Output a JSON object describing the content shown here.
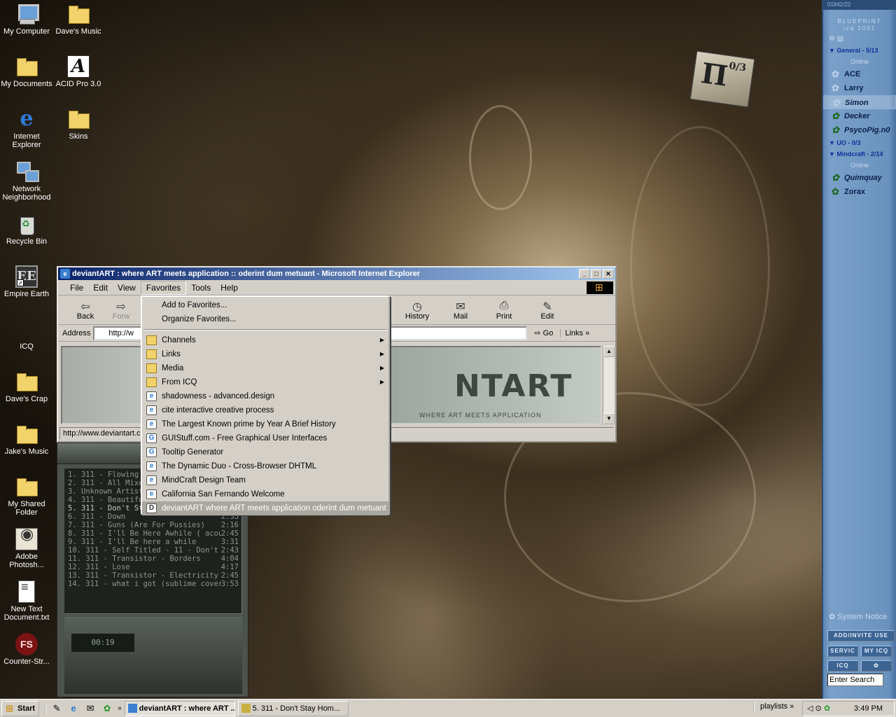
{
  "desktop": {
    "icons": [
      {
        "label": "My Computer",
        "icon": "computer-icon"
      },
      {
        "label": "Dave's Music",
        "icon": "folder-icon"
      },
      {
        "label": "My Documents",
        "icon": "folder-icon"
      },
      {
        "label": "ACID Pro 3.0",
        "icon": "acid-icon"
      },
      {
        "label": "Internet Explorer",
        "icon": "ie-icon"
      },
      {
        "label": "Skins",
        "icon": "folder-icon"
      },
      {
        "label": "Network Neighborhood",
        "icon": "network-icon"
      },
      {
        "label": "Recycle Bin",
        "icon": "recycle-bin-icon"
      },
      {
        "label": "Empire Earth",
        "icon": "empire-earth-icon"
      },
      {
        "label": "ICQ",
        "icon": "icq-icon"
      },
      {
        "label": "Dave's Crap",
        "icon": "folder-icon"
      },
      {
        "label": "Jake's Music",
        "icon": "folder-icon"
      },
      {
        "label": "My Shared Folder",
        "icon": "folder-icon"
      },
      {
        "label": "Adobe Photosh...",
        "icon": "photoshop-icon"
      },
      {
        "label": "New Text Document.txt",
        "icon": "text-file-icon"
      },
      {
        "label": "Counter-Str...",
        "icon": "counter-strike-icon"
      }
    ]
  },
  "ie": {
    "title": "deviantART : where ART meets application :: oderint dum metuant - Microsoft Internet Explorer",
    "menu": [
      "File",
      "Edit",
      "View",
      "Favorites",
      "Tools",
      "Help"
    ],
    "toolbar": {
      "back": "Back",
      "forward": "Forw",
      "history": "History",
      "mail": "Mail",
      "print": "Print",
      "edit": "Edit"
    },
    "address_label": "Address",
    "address_value": "http://w",
    "go": "Go",
    "links": "Links",
    "banner_logo": "NTART",
    "banner_tag": "WHERE ART MEETS APPLICATION",
    "status": "http://www.deviantart.c"
  },
  "favorites_menu": {
    "top_items": [
      "Add to Favorites...",
      "Organize Favorites..."
    ],
    "folders": [
      "Channels",
      "Links",
      "Media",
      "From ICQ"
    ],
    "links": [
      "shadowness - advanced.design",
      "cite interactive  creative process",
      "The Largest Known prime by Year A Brief History",
      "GUIStuff.com - Free Graphical User Interfaces",
      "Tooltip Generator",
      "The Dynamic Duo - Cross-Browser DHTML",
      "MindCraft Design Team",
      "California San Fernando  Welcome",
      "deviantART  where ART meets application  oderint dum metuant"
    ]
  },
  "player": {
    "playlist": [
      {
        "title": "1. 311 - Flowing",
        "time": ""
      },
      {
        "title": "2. 311 - All Mixed",
        "time": ""
      },
      {
        "title": "3. Unknown Artist",
        "time": ""
      },
      {
        "title": "4. 311 - Beautiful",
        "time": ""
      },
      {
        "title": "5. 311 - Don't Sta",
        "time": ""
      },
      {
        "title": "6. 311 - Down",
        "time": "2:53"
      },
      {
        "title": "7. 311 - Guns (Are For Pussies)",
        "time": "2:16"
      },
      {
        "title": "8. 311 - I'll Be Here Awhile ( acou...",
        "time": "2:45"
      },
      {
        "title": "9. 311 - I'll Be here a while",
        "time": "3:31"
      },
      {
        "title": "10. 311 - Self Titled - 11 - Don't St...",
        "time": "2:43"
      },
      {
        "title": "11. 311 - Transistor - Borders",
        "time": "4:04"
      },
      {
        "title": "12. 311 - Lose",
        "time": "4:17"
      },
      {
        "title": "13. 311 - Transistor - Electricity",
        "time": "2:45"
      },
      {
        "title": "14. 311 - what i got (sublime cover)",
        "time": "3:53"
      }
    ],
    "display_time": "00:19"
  },
  "icq": {
    "header": "01842/22",
    "brand_line1": "BLUEPRINT",
    "brand_line2": "icq 2001",
    "group_general": "General - 5/13",
    "online": "Online",
    "contacts_general": [
      "ACE",
      "Larry",
      "Simon",
      "Decker",
      "PsycoPig.n0"
    ],
    "group_uo": "UO - 0/3",
    "group_mindcraft": "Mindcraft - 2/14",
    "contacts_mindcraft": [
      "Quimquay",
      "Zorax"
    ],
    "system_notice": "System Notice",
    "btn_add": "ADD/INVITE USE",
    "btn_services": "SERVIC",
    "btn_myicq": "MY ICQ",
    "btn_icq": "ICQ",
    "search_placeholder": "Enter Search"
  },
  "taskbar": {
    "start": "Start",
    "tasks": [
      "deviantART : where ART ...",
      "5. 311 - Don't Stay Hom..."
    ],
    "playlists": "playlists",
    "clock": "3:49 PM"
  }
}
